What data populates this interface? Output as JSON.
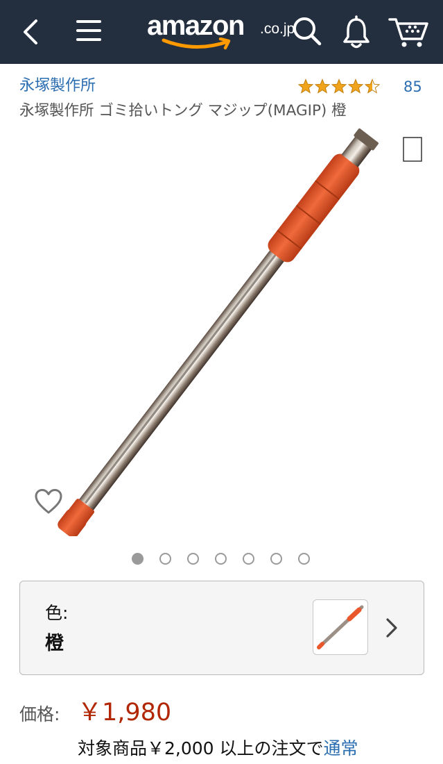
{
  "header": {
    "logo_text": "amazon",
    "logo_tld": ".co.jp",
    "icons": [
      "back-arrow-icon",
      "menu-icon",
      "search-icon",
      "bell-icon",
      "cart-icon"
    ],
    "background_color": "#232f3e",
    "logo_accent_color": "#ff9900"
  },
  "product": {
    "brand": "永塚製作所",
    "rating": 4.5,
    "rating_max": 5,
    "review_count": "85",
    "title": "永塚製作所 ゴミ拾いトング マジップ(MAGIP) 橙",
    "image_count": 7,
    "active_image_index": 0
  },
  "variant": {
    "label": "色:",
    "value": "橙"
  },
  "price": {
    "label": "価格:",
    "value": "￥1,980"
  },
  "shipping": {
    "text": "対象商品￥2,000 以上の注文で",
    "link": "通常"
  },
  "colors": {
    "link": "#2a6db0",
    "price": "#b12704",
    "star": "#f0a41c",
    "tong_orange": "#e8582c"
  }
}
